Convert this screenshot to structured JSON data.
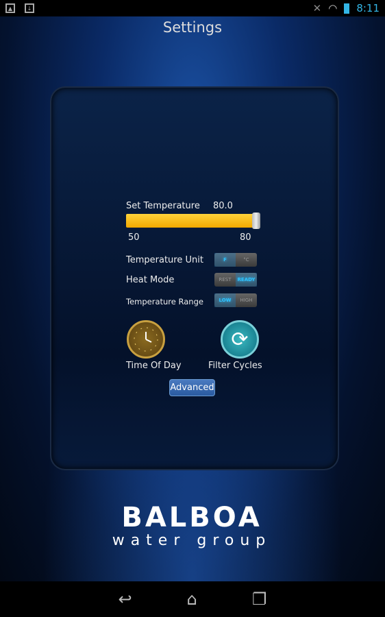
{
  "status_bar": {
    "time": "8:11",
    "icons": [
      "gallery-icon",
      "download-icon",
      "mute-icon",
      "wifi-icon",
      "battery-icon"
    ]
  },
  "header": {
    "title": "Settings"
  },
  "temperature": {
    "label": "Set Temperature",
    "value": "80.0",
    "min": "50",
    "max": "80",
    "slider_fraction": 1.0,
    "accent": "#f7b800"
  },
  "toggles": [
    {
      "label": "Temperature Unit",
      "options": [
        "F",
        "°C"
      ],
      "selected": "F"
    },
    {
      "label": "Heat Mode",
      "options": [
        "REST",
        "READY"
      ],
      "selected": "READY"
    },
    {
      "label": "Temperature Range",
      "options": [
        "LOW",
        "HIGH"
      ],
      "selected": "LOW"
    }
  ],
  "buttons": {
    "time_of_day": "Time Of Day",
    "filter_cycles": "Filter Cycles",
    "advanced": "Advanced"
  },
  "logo": {
    "brand": "BALBOA",
    "tagline": "water group"
  },
  "nav": [
    "back-icon",
    "home-icon",
    "recent-apps-icon"
  ]
}
